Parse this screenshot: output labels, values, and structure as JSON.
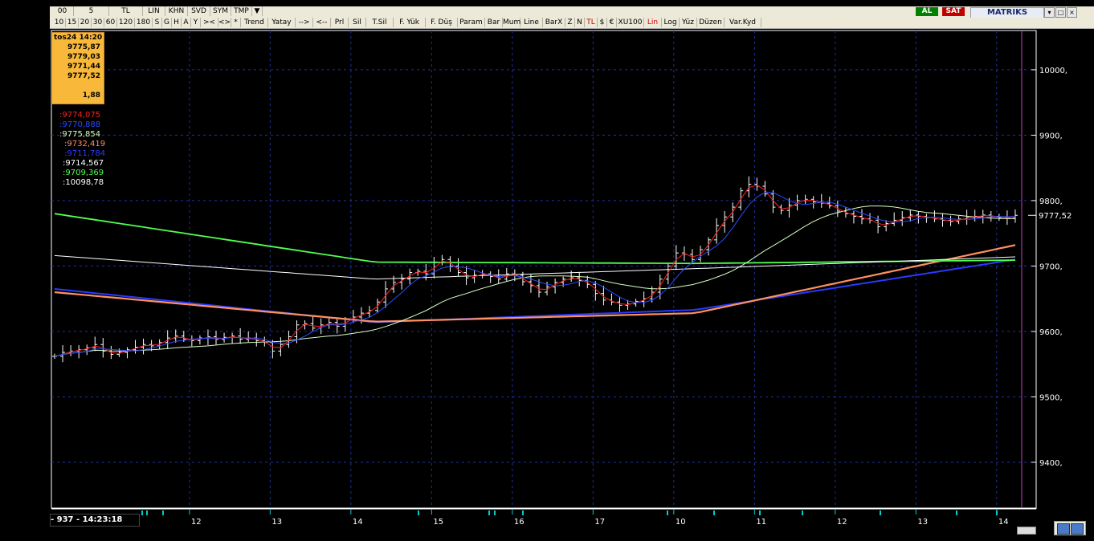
{
  "toolbar_row1": {
    "items": [
      "00",
      "5",
      "TL",
      "LIN",
      "KHN",
      "SVD",
      "SYM",
      "TMP"
    ],
    "al_label": "AL",
    "sat_label": "SAT",
    "logo": "MATRIKS"
  },
  "toolbar_row2": {
    "items": [
      "10",
      "15",
      "20",
      "30",
      "60",
      "120",
      "180",
      "S",
      "G",
      "H",
      "A",
      "Y",
      ">< ",
      "<>",
      "*",
      "Trend",
      "Yatay",
      "-->",
      "<--",
      "Prl",
      "Sil",
      "T.Sil",
      "F. Yük",
      "F. Düş",
      "Param",
      "Bar",
      "Mum",
      "Line",
      "BarX",
      "Z",
      "N",
      "TL",
      "$",
      "€",
      "XU100",
      "Lin",
      "Log",
      "Yüz",
      "Düzen",
      "Var.Kyd"
    ],
    "red_items": [
      "TL",
      "Lin"
    ]
  },
  "info_box": {
    "datetime": "tos24 14:20",
    "open": "9775,87",
    "high": "9779,03",
    "low": "9771,44",
    "close": "9777,52",
    "change": "1,88"
  },
  "indicator_values": [
    {
      "text": ":9774,075",
      "color": "#ff2020"
    },
    {
      "text": ":9770,888",
      "color": "#2a4aff"
    },
    {
      "text": ":9775,854",
      "color": "#d8ffc0"
    },
    {
      "text": ":9732,419",
      "color": "#ff9060"
    },
    {
      "text": ":9711,784",
      "color": "#2a3aff"
    },
    {
      "text": ":9714,567",
      "color": "#ffffff"
    },
    {
      "text": ":9709,369",
      "color": "#50ff50"
    },
    {
      "text": ":10098,78",
      "color": "#ffffff"
    }
  ],
  "status": {
    "text": "- 937 - 14:23:18"
  },
  "chart_data": {
    "type": "bar",
    "yticks": [
      9400,
      9500,
      9600,
      9700,
      9800,
      9900,
      10000
    ],
    "ytick_labels": [
      "9400,",
      "9500,",
      "9600,",
      "9700,",
      "9800,",
      "9900,",
      "10000,"
    ],
    "ylim": [
      9330,
      10060
    ],
    "last_price": 9777.52,
    "last_price_label": "9777,52",
    "xticks": [
      {
        "label": "12",
        "i": 17
      },
      {
        "label": "13",
        "i": 27
      },
      {
        "label": "14",
        "i": 37
      },
      {
        "label": "15",
        "i": 47
      },
      {
        "label": "16",
        "i": 57
      },
      {
        "label": "17",
        "i": 67
      },
      {
        "label": "10",
        "i": 77
      },
      {
        "label": "11",
        "i": 87
      },
      {
        "label": "12",
        "i": 97
      },
      {
        "label": "13",
        "i": 107
      },
      {
        "label": "14",
        "i": 117
      }
    ],
    "n_bars": 120,
    "closes": [
      9562,
      9568,
      9570,
      9572,
      9575,
      9580,
      9570,
      9565,
      9568,
      9572,
      9576,
      9580,
      9578,
      9583,
      9590,
      9593,
      9588,
      9586,
      9590,
      9592,
      9588,
      9591,
      9593,
      9588,
      9590,
      9586,
      9583,
      9570,
      9580,
      9592,
      9610,
      9612,
      9605,
      9610,
      9614,
      9608,
      9618,
      9622,
      9628,
      9632,
      9645,
      9665,
      9675,
      9680,
      9690,
      9692,
      9688,
      9705,
      9710,
      9700,
      9690,
      9682,
      9686,
      9688,
      9684,
      9680,
      9688,
      9686,
      9676,
      9670,
      9660,
      9668,
      9675,
      9680,
      9682,
      9678,
      9672,
      9658,
      9648,
      9645,
      9640,
      9642,
      9646,
      9650,
      9660,
      9680,
      9700,
      9720,
      9718,
      9710,
      9725,
      9740,
      9762,
      9775,
      9790,
      9815,
      9825,
      9822,
      9810,
      9790,
      9785,
      9793,
      9800,
      9802,
      9798,
      9796,
      9792,
      9784,
      9780,
      9776,
      9772,
      9770,
      9760,
      9765,
      9770,
      9774,
      9778,
      9776,
      9774,
      9772,
      9770,
      9768,
      9772,
      9774,
      9776,
      9778,
      9776,
      9774,
      9773,
      9777.52
    ],
    "series": [
      {
        "color": "#2a3aff",
        "width": 2,
        "values": [
          9665,
          9614,
          9633,
          9710
        ]
      },
      {
        "color": "#ff9060",
        "width": 2.2,
        "values": [
          9660,
          9615,
          9628,
          9732
        ]
      },
      {
        "color": "#50ff50",
        "width": 1.8,
        "values": [
          9780,
          9706,
          9704,
          9709
        ]
      },
      {
        "color": "#ffffff",
        "width": 1,
        "values": [
          9716,
          9680,
          9696,
          9714
        ]
      },
      {
        "color": "#d8ffc0",
        "width": 1,
        "values": [
          9645,
          9590,
          9640,
          9776
        ]
      },
      {
        "color": "#ff2020",
        "width": 1,
        "values": [
          9567,
          9640,
          9820,
          9774
        ]
      },
      {
        "color": "#2a4aff",
        "width": 1,
        "values": [
          9565,
          9630,
          9805,
          9771
        ]
      }
    ]
  }
}
